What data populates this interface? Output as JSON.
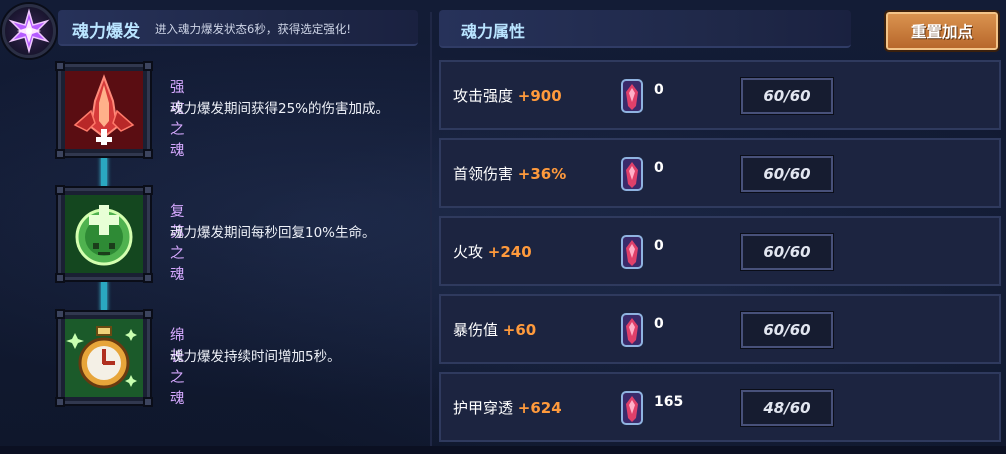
{
  "burst": {
    "title": "魂力爆发",
    "description": "进入魂力爆发状态6秒，获得选定强化!",
    "icon": "purple-star-crystal-icon"
  },
  "skills": [
    {
      "name": "强攻之魂",
      "description": "魂力爆发期间获得25%的伤害加成。",
      "icon": "red-rocket-soul-icon",
      "color": "#c0302a"
    },
    {
      "name": "复苏之魂",
      "description": "魂力爆发期间每秒回复10%生命。",
      "icon": "green-heal-soul-icon",
      "color": "#3aa84a"
    },
    {
      "name": "绵长之魂",
      "description": "魂力爆发持续时间增加5秒。",
      "icon": "green-stopwatch-soul-icon",
      "color": "#2f9a45"
    }
  ],
  "attributes": {
    "title": "魂力属性",
    "reset_label": "重置加点",
    "rows": [
      {
        "label": "攻击强度",
        "bonus": "+900",
        "gem_count": "0",
        "cap": "60/60"
      },
      {
        "label": "首领伤害",
        "bonus": "+36%",
        "gem_count": "0",
        "cap": "60/60"
      },
      {
        "label": "火攻",
        "bonus": "+240",
        "gem_count": "0",
        "cap": "60/60"
      },
      {
        "label": "暴伤值",
        "bonus": "+60",
        "gem_count": "0",
        "cap": "60/60"
      },
      {
        "label": "护甲穿透",
        "bonus": "+624",
        "gem_count": "165",
        "cap": "48/60"
      }
    ]
  },
  "colors": {
    "accent_title": "#b9e4ff",
    "skill_name": "#d6a9ff",
    "bonus": "#ff9a3c",
    "reset_button": "#c97a3c"
  }
}
